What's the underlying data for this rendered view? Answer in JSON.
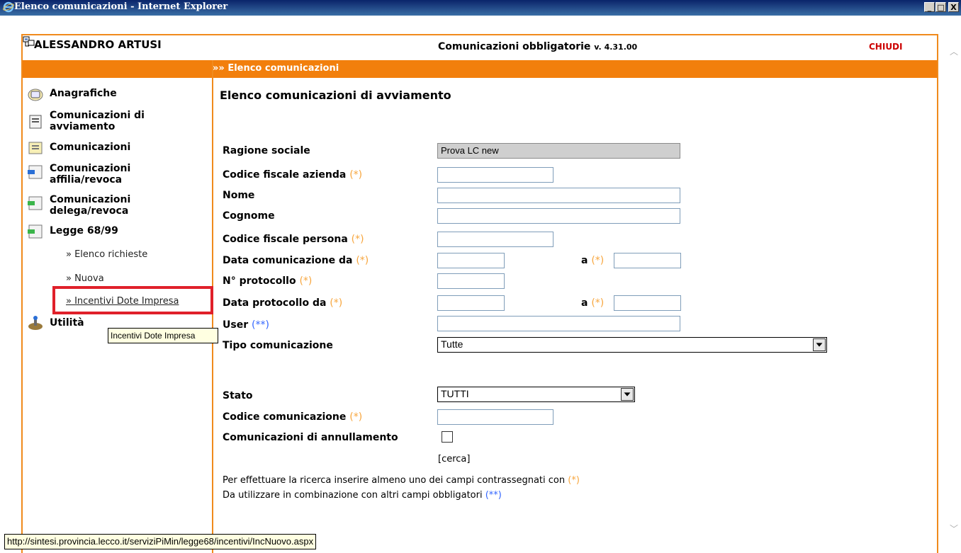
{
  "window": {
    "title": "Elenco comunicazioni - Internet Explorer",
    "minimize": "_",
    "maximize": "□",
    "close": "X"
  },
  "header": {
    "user_name": "ALESSANDRO ARTUSI",
    "app_title": "Comunicazioni obbligatorie",
    "version": "v. 4.31.00",
    "close_label": "CHIUDI"
  },
  "breadcrumb": "»» Elenco comunicazioni",
  "sidebar": {
    "items": [
      {
        "label": "Anagrafiche",
        "icon": "address-book-icon"
      },
      {
        "label": "Comunicazioni di avviamento",
        "icon": "document-icon"
      },
      {
        "label": "Comunicazioni",
        "icon": "folder-document-icon"
      },
      {
        "label": "Comunicazioni affilia/revoca",
        "icon": "document-blue-icon"
      },
      {
        "label": "Comunicazioni delega/revoca",
        "icon": "document-green-icon"
      },
      {
        "label": "Legge 68/99",
        "icon": "document-green-icon"
      }
    ],
    "subitems": [
      "» Elenco richieste",
      "» Nuova",
      "» Incentivi Dote Impresa"
    ],
    "utilita": "Utilità",
    "tooltip": "Incentivi Dote Impresa"
  },
  "main": {
    "title": "Elenco comunicazioni di avviamento",
    "fields": {
      "ragione_sociale": {
        "label": "Ragione sociale",
        "value": "Prova LC new"
      },
      "codice_fiscale_azienda": {
        "label": "Codice fiscale azienda",
        "req": "(*)"
      },
      "nome": {
        "label": "Nome"
      },
      "cognome": {
        "label": "Cognome"
      },
      "codice_fiscale_persona": {
        "label": "Codice fiscale persona",
        "req": "(*)"
      },
      "data_comunicazione": {
        "label": "Data comunicazione da",
        "req": "(*)",
        "a_label": "a",
        "a_req": "(*)"
      },
      "protocollo": {
        "label": "N° protocollo",
        "req": "(*)"
      },
      "data_protocollo": {
        "label": "Data protocollo da",
        "req": "(*)",
        "a_label": "a",
        "a_req": "(*)"
      },
      "user": {
        "label": "User",
        "req": "(**)"
      },
      "tipo_comunicazione": {
        "label": "Tipo comunicazione",
        "value": "Tutte"
      },
      "stato": {
        "label": "Stato",
        "value": "TUTTI"
      },
      "codice_comunicazione": {
        "label": "Codice comunicazione",
        "req": "(*)"
      },
      "annullamento": {
        "label": "Comunicazioni di annullamento"
      }
    },
    "search_link": "[cerca]",
    "note1": "Per effettuare la ricerca inserire almeno uno dei campi contrassegnati con",
    "note1_req": "(*)",
    "note2": "Da utilizzare in combinazione con altri campi obbligatori",
    "note2_req": "(**)"
  },
  "status_url": "http://sintesi.provincia.lecco.it/serviziPiMin/legge68/incentivi/IncNuovo.aspx",
  "colors": {
    "accent": "#f27f0c",
    "highlight": "#e0202a",
    "required": "#f7a63e",
    "required2": "#3366ff"
  }
}
